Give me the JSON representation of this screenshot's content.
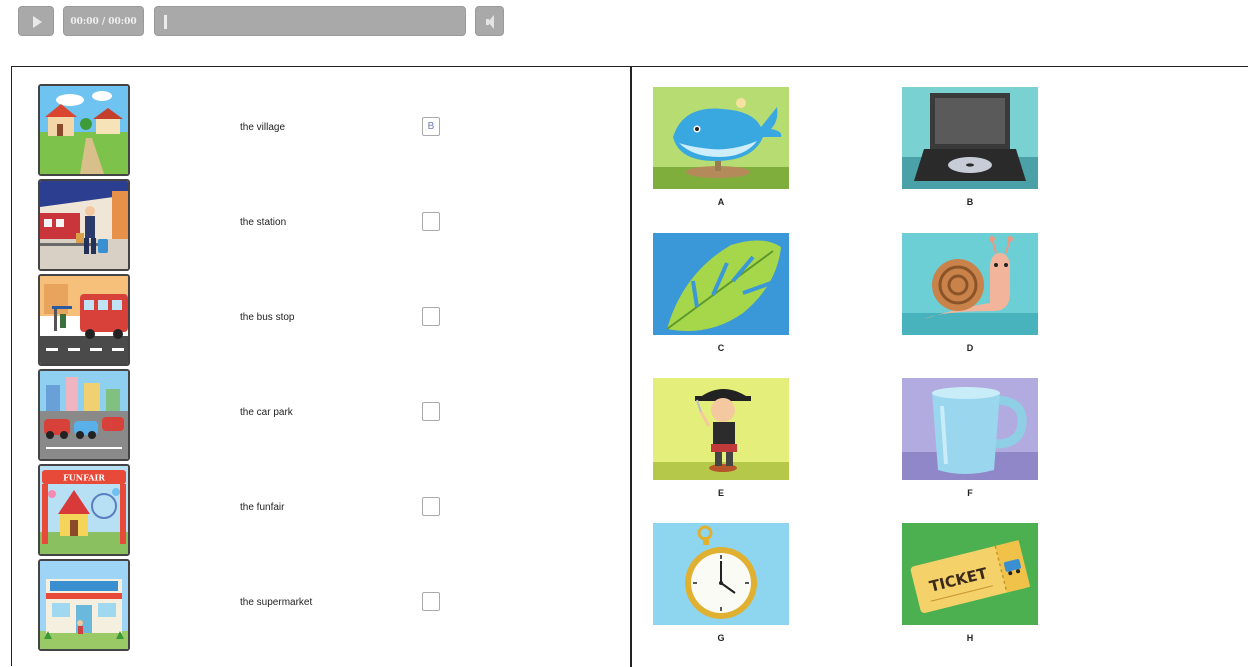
{
  "player": {
    "time": "00:00 / 00:00",
    "progress": 0
  },
  "rows": [
    {
      "label": "the village",
      "answer": "B"
    },
    {
      "label": "the station",
      "answer": ""
    },
    {
      "label": "the bus stop",
      "answer": ""
    },
    {
      "label": "the car park",
      "answer": ""
    },
    {
      "label": "the funfair",
      "answer": ""
    },
    {
      "label": "the supermarket",
      "answer": ""
    }
  ],
  "signs": {
    "funfair": "FUNFAIR",
    "ticket": "TICKET"
  },
  "options": [
    {
      "letter": "A",
      "icon": "whale-icon"
    },
    {
      "letter": "B",
      "icon": "dvd-player-icon"
    },
    {
      "letter": "C",
      "icon": "leaf-icon"
    },
    {
      "letter": "D",
      "icon": "snail-icon"
    },
    {
      "letter": "E",
      "icon": "pirate-figure-icon"
    },
    {
      "letter": "F",
      "icon": "mug-icon"
    },
    {
      "letter": "G",
      "icon": "pocket-watch-icon"
    },
    {
      "letter": "H",
      "icon": "ticket-icon"
    }
  ],
  "colors": {
    "player_gray": "#a9a9a9",
    "answer_text": "#6a7db0",
    "frame": "#222222"
  }
}
